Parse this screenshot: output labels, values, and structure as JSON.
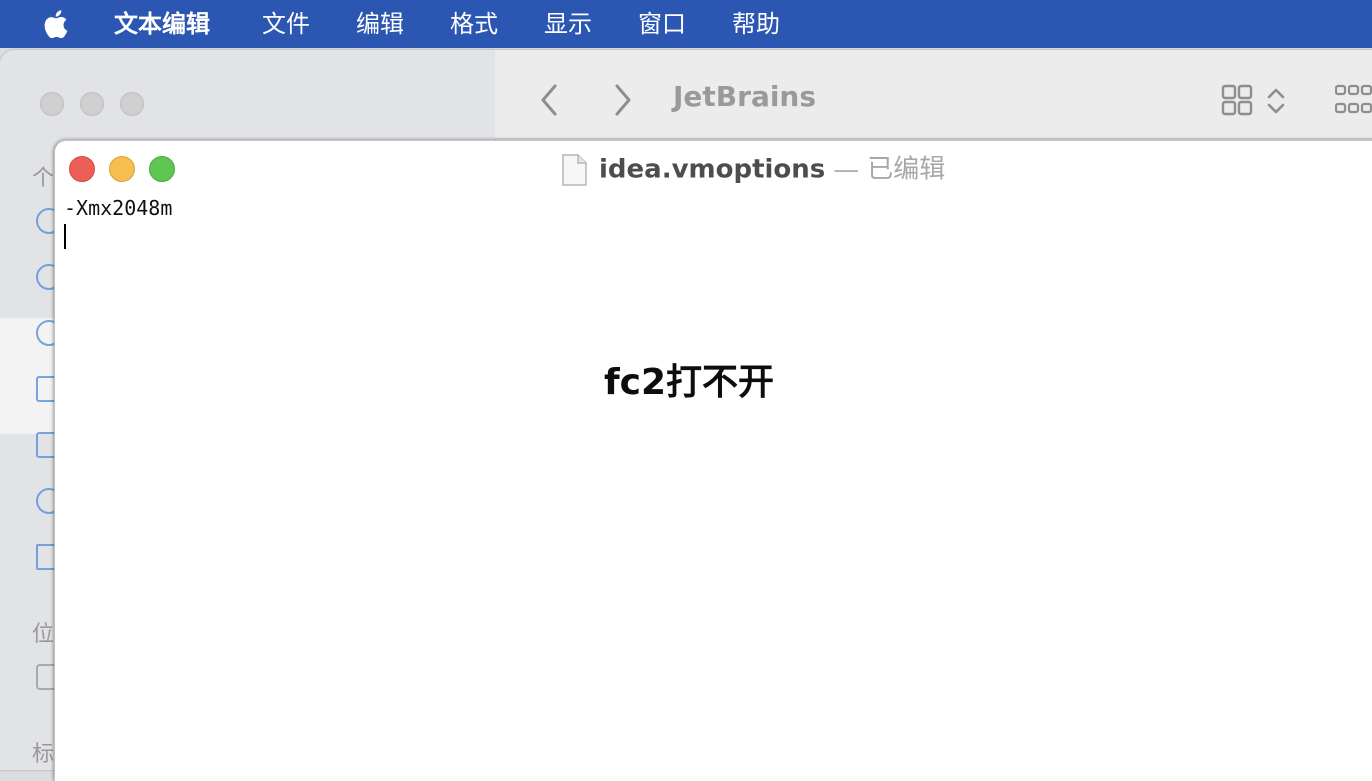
{
  "menubar": {
    "apple_icon": "apple-logo-icon",
    "items": [
      "文本编辑",
      "文件",
      "编辑",
      "格式",
      "显示",
      "窗口",
      "帮助"
    ]
  },
  "finder": {
    "title": "JetBrains",
    "sidebar_headings": [
      "个",
      "位",
      "标"
    ]
  },
  "textedit": {
    "file_name": "idea.vmoptions",
    "separator": "—",
    "status": "已编辑",
    "lines": [
      "-Xmx2048m",
      ""
    ]
  },
  "overlay": {
    "text": "fc2打不开"
  },
  "colors": {
    "menubar": "#2b57b3",
    "close": "#ec5f57",
    "minimize": "#f5be4f",
    "zoom": "#61c554"
  }
}
